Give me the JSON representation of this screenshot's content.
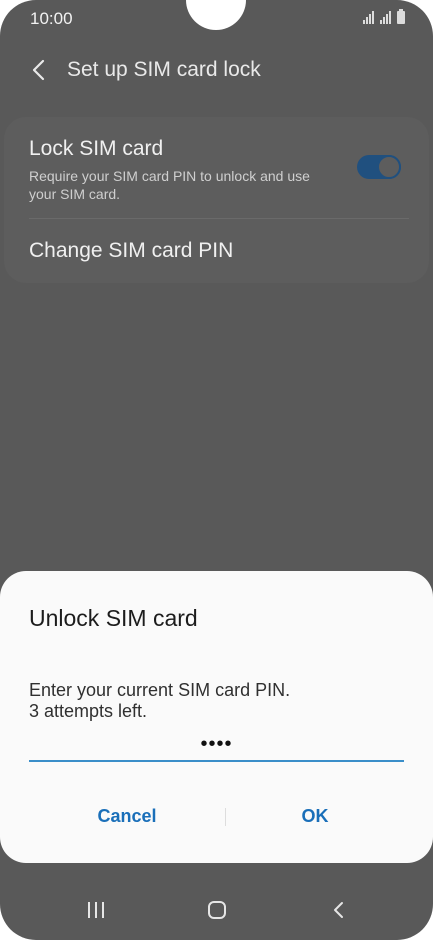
{
  "status_bar": {
    "time": "10:00"
  },
  "header": {
    "title": "Set up SIM card lock"
  },
  "settings": {
    "lock_sim": {
      "title": "Lock SIM card",
      "subtitle": "Require your SIM card PIN to unlock and use your SIM card.",
      "enabled": true
    },
    "change_pin": {
      "title": "Change SIM card PIN"
    }
  },
  "dialog": {
    "title": "Unlock SIM card",
    "message_line1": "Enter your current SIM card PIN.",
    "message_line2": "3 attempts left.",
    "pin_value": "••••",
    "cancel_label": "Cancel",
    "ok_label": "OK"
  },
  "colors": {
    "accent": "#1a6fb9",
    "scrim": "#595959",
    "dialog_bg": "#fafafa"
  }
}
